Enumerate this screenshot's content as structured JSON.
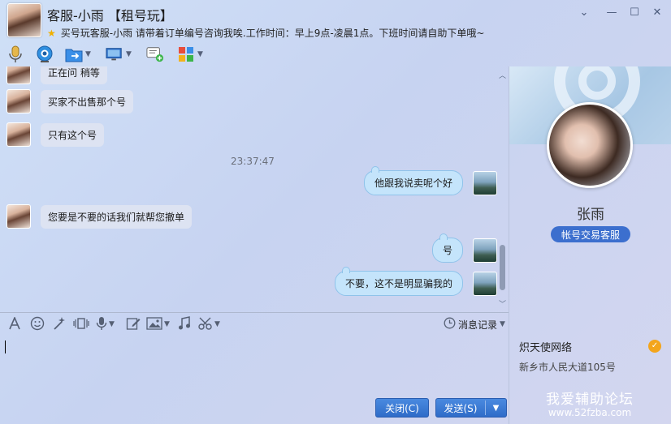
{
  "window": {
    "title": "客服-小雨 【租号玩】",
    "subtitle": "买号玩客服-小雨  请带着订单编号咨询我唉.工作时间：早上9点-凌晨1点。下班时间请自助下单哦~",
    "controls": {
      "menu": "⌄",
      "minimize": "—",
      "maximize": "☐",
      "close": "✕"
    }
  },
  "toolbar": {
    "icons": [
      "microphone-icon",
      "camera-icon",
      "folder-transfer-icon",
      "screen-share-icon",
      "message-add-icon",
      "apps-grid-icon"
    ]
  },
  "chat": {
    "messages": [
      {
        "side": "in",
        "text": "正在问 稍等"
      },
      {
        "side": "in",
        "text": "买家不出售那个号"
      },
      {
        "side": "in",
        "text": "只有这个号"
      },
      {
        "side": "time",
        "text": "23:37:47"
      },
      {
        "side": "out",
        "text": "他跟我说卖呢个好"
      },
      {
        "side": "in",
        "text": "您要是不要的话我们就帮您撤单"
      },
      {
        "side": "out",
        "text": "号"
      },
      {
        "side": "out",
        "text": "不要，这不是明显骗我的"
      }
    ]
  },
  "input_toolbar": {
    "history_label": "消息记录"
  },
  "buttons": {
    "close_label": "关闭(C)",
    "send_label": "发送(S)"
  },
  "profile": {
    "name": "张雨",
    "role": "帐号交易客服",
    "company": "炽天使网络",
    "address": "新乡市人民大道105号"
  },
  "watermark": {
    "line1": "我爱辅助论坛",
    "line2": "www.52fzba.com"
  },
  "colors": {
    "accent": "#3c6fce",
    "button": "#2f6cc8",
    "bubble_out": "#c4e4fb",
    "bubble_in": "#dde3f2"
  }
}
